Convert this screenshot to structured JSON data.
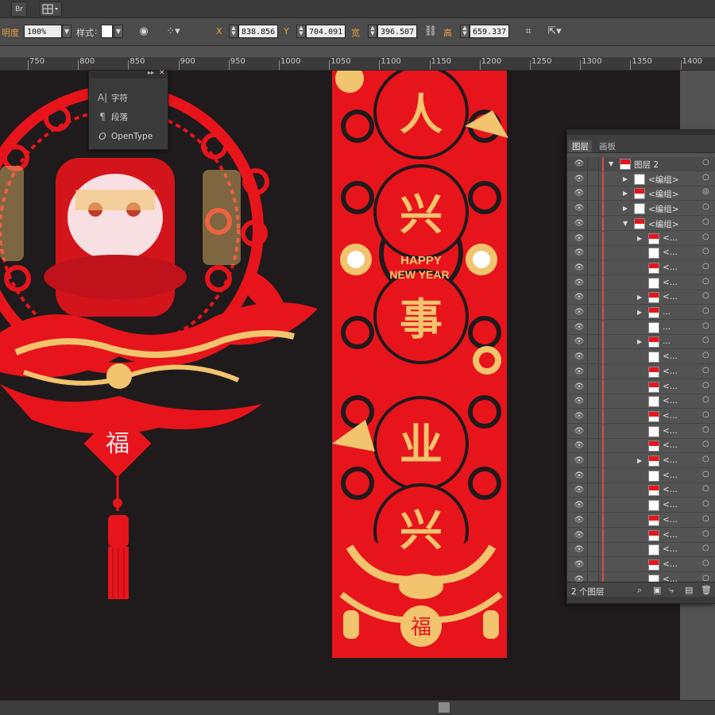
{
  "appbar": {
    "bridge_label": "Br",
    "arrange_icon": "arrange-documents-icon"
  },
  "control": {
    "opacity_label": "明度",
    "opacity_value": "100%",
    "style_label": "样式",
    "x_label": "X",
    "x_value": "838.856",
    "y_label": "Y",
    "y_value": "704.091",
    "w_label": "宽",
    "w_value": "396.507",
    "h_label": "高",
    "h_value": "659.337"
  },
  "ruler": {
    "ticks": [
      "750",
      "800",
      "850",
      "900",
      "950",
      "1000",
      "1050",
      "1100",
      "1150",
      "1200",
      "1250",
      "1300",
      "1350",
      "1400"
    ]
  },
  "char_panel": {
    "items": [
      {
        "icon": "A|",
        "label": "字符"
      },
      {
        "icon": "¶",
        "label": "段落"
      },
      {
        "icon": "O",
        "label": "OpenType"
      }
    ]
  },
  "couplet": {
    "chars": [
      "人",
      "兴",
      "事",
      "业",
      "兴"
    ],
    "banner_line1": "HAPPY",
    "banner_line2": "NEW YEAR",
    "bottom_char": "福",
    "colors": {
      "red": "#e8141c",
      "gold": "#f2c46e",
      "dark": "#1f1a1b"
    }
  },
  "ornament": {
    "fu_char": "福",
    "colors": {
      "red": "#e8141c",
      "gold": "#f2c46e"
    }
  },
  "layers": {
    "tabs": [
      "图层",
      "画板"
    ],
    "rows": [
      {
        "name": "图层 2",
        "depth": 0,
        "tri": "▼",
        "target": "○"
      },
      {
        "name": "<编组>",
        "depth": 1,
        "tri": "▶",
        "target": "○"
      },
      {
        "name": "<编组>",
        "depth": 1,
        "tri": "▶",
        "target": "◎"
      },
      {
        "name": "<编组>",
        "depth": 1,
        "tri": "▶",
        "target": "○"
      },
      {
        "name": "<编组>",
        "depth": 1,
        "tri": "▼",
        "target": "○"
      },
      {
        "name": "<...",
        "depth": 2,
        "tri": "▶",
        "target": "○"
      },
      {
        "name": "<...",
        "depth": 2,
        "tri": "",
        "target": "○"
      },
      {
        "name": "<...",
        "depth": 2,
        "tri": "",
        "target": "○"
      },
      {
        "name": "<...",
        "depth": 2,
        "tri": "",
        "target": "○"
      },
      {
        "name": "<...",
        "depth": 2,
        "tri": "▶",
        "target": "○"
      },
      {
        "name": "...",
        "depth": 2,
        "tri": "▶",
        "target": "○"
      },
      {
        "name": "...",
        "depth": 2,
        "tri": "",
        "target": "○"
      },
      {
        "name": "...",
        "depth": 2,
        "tri": "▶",
        "target": "○"
      },
      {
        "name": "<...",
        "depth": 2,
        "tri": "",
        "target": "○"
      },
      {
        "name": "<...",
        "depth": 2,
        "tri": "",
        "target": "○"
      },
      {
        "name": "<...",
        "depth": 2,
        "tri": "",
        "target": "○"
      },
      {
        "name": "<...",
        "depth": 2,
        "tri": "",
        "target": "○"
      },
      {
        "name": "<...",
        "depth": 2,
        "tri": "",
        "target": "○"
      },
      {
        "name": "<...",
        "depth": 2,
        "tri": "",
        "target": "○"
      },
      {
        "name": "<...",
        "depth": 2,
        "tri": "",
        "target": "○"
      },
      {
        "name": "<...",
        "depth": 2,
        "tri": "▶",
        "target": "○"
      },
      {
        "name": "<...",
        "depth": 2,
        "tri": "",
        "target": "○"
      },
      {
        "name": "<...",
        "depth": 2,
        "tri": "",
        "target": "○"
      },
      {
        "name": "<...",
        "depth": 2,
        "tri": "",
        "target": "○"
      },
      {
        "name": "<...",
        "depth": 2,
        "tri": "",
        "target": "○"
      },
      {
        "name": "<...",
        "depth": 2,
        "tri": "",
        "target": "○"
      },
      {
        "name": "<...",
        "depth": 2,
        "tri": "",
        "target": "○"
      },
      {
        "name": "<...",
        "depth": 2,
        "tri": "",
        "target": "○"
      },
      {
        "name": "<...",
        "depth": 2,
        "tri": "",
        "target": "○"
      }
    ],
    "footer_count": "2 个图层"
  }
}
